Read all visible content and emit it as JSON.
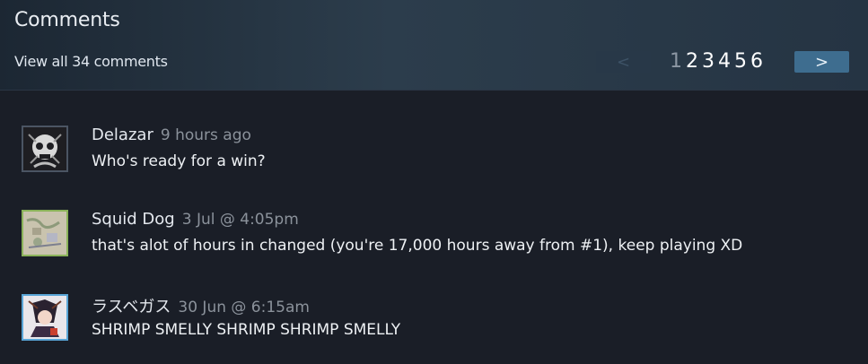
{
  "header": {
    "title": "Comments",
    "view_all": "View all 34 comments"
  },
  "pagination": {
    "prev_label": "<",
    "next_label": ">",
    "pages": [
      "1",
      "2",
      "3",
      "4",
      "5",
      "6"
    ],
    "current": "1"
  },
  "comments": [
    {
      "author": "Delazar",
      "time": "9 hours ago",
      "text": "Who's ready for a win?",
      "avatar_icon": "skull-avatar-icon"
    },
    {
      "author": "Squid Dog",
      "time": "3 Jul @ 4:05pm",
      "text": "that's alot of hours in changed (you're 17,000 hours away from #1), keep playing XD",
      "avatar_icon": "map-avatar-icon"
    },
    {
      "author": "ラスベガス",
      "time": "30 Jun @ 6:15am",
      "text": "SHRIMP SMELLY SHRIMP SHRIMP SMELLY",
      "avatar_icon": "anime-avatar-icon"
    }
  ],
  "colors": {
    "background": "#1a1e27",
    "header_gradient_mid": "#2c3d4c",
    "next_button": "#3e6d8f",
    "prev_button": "#283848",
    "author_text": "#e4e8ee",
    "timestamp_text": "#8b929b",
    "online_avatar_border": "#59a5d6",
    "ingame_avatar_border": "#8bb35a"
  }
}
